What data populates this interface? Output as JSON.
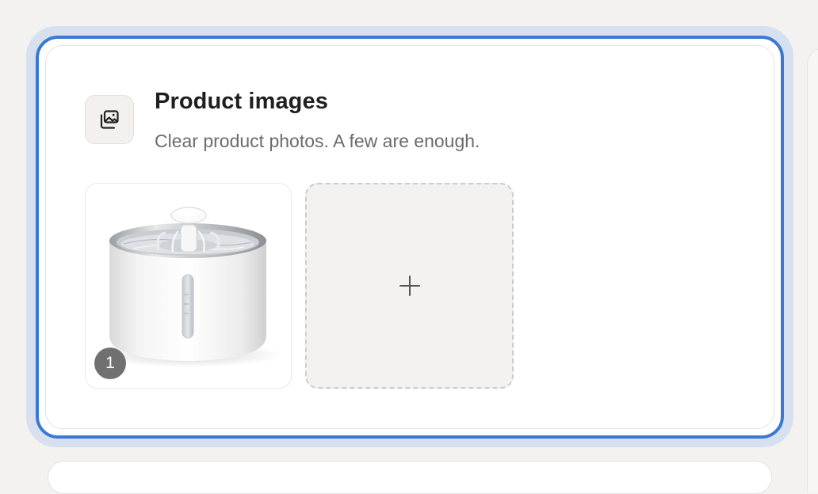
{
  "section": {
    "icon": "image-gallery-icon",
    "title": "Product images",
    "subtitle": "Clear product photos. A few are enough."
  },
  "images": [
    {
      "position_badge": "1",
      "subject": "pet-water-fountain-photo"
    }
  ],
  "add_tile": {
    "icon": "plus-icon"
  },
  "colors": {
    "focus_border": "#3a78d4",
    "focus_glow": "#d6e0ef",
    "page_background": "#f3f2f0",
    "badge_background": "#707070"
  }
}
